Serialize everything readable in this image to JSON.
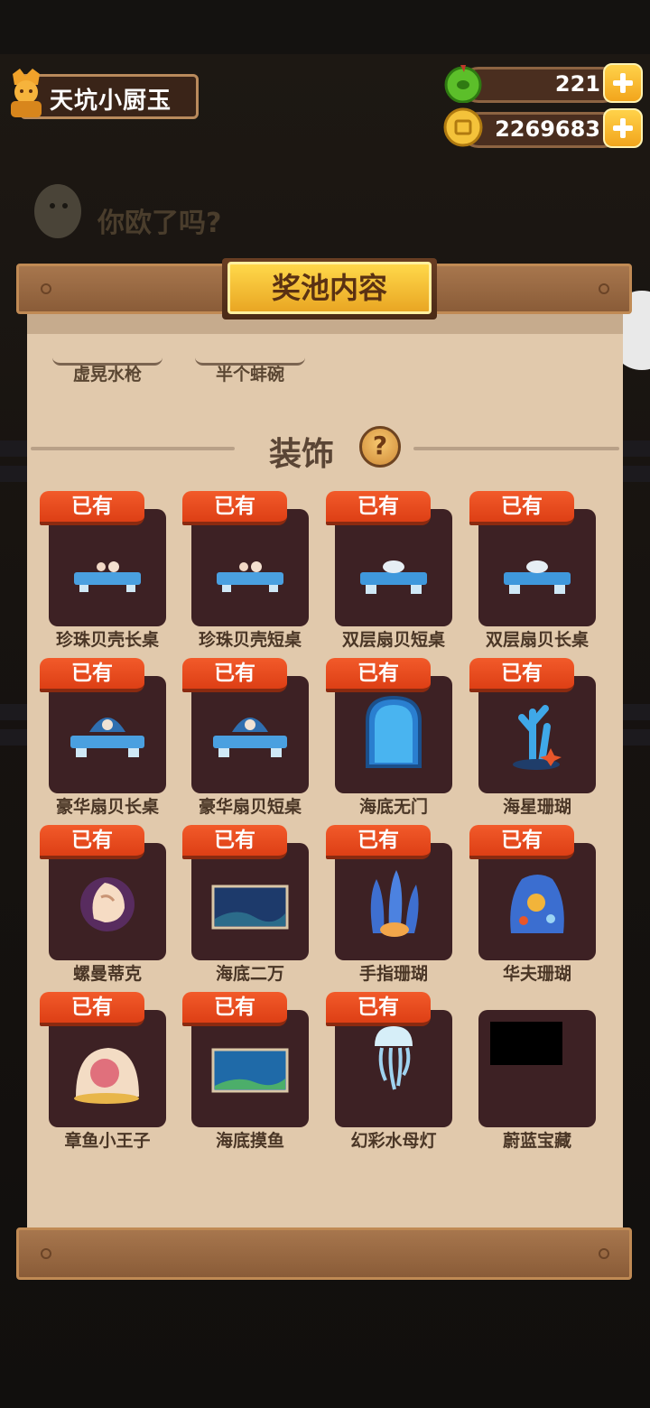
{
  "header": {
    "player_name": "天坑小厨玉",
    "gems": "221",
    "coins": "2269683",
    "banner_text": "你欧了吗?"
  },
  "panel": {
    "title": "奖池内容",
    "previous_items": [
      "虚晃水枪",
      "半个蚌碗"
    ],
    "section_title": "装饰",
    "help_symbol": "?",
    "owned_tag": "已有",
    "items": [
      {
        "name": "珍珠贝壳长桌",
        "owned": true,
        "icon": "pearl-shell-long-table"
      },
      {
        "name": "珍珠贝壳短桌",
        "owned": true,
        "icon": "pearl-shell-short-table"
      },
      {
        "name": "双层扇贝短桌",
        "owned": true,
        "icon": "double-scallop-short-table"
      },
      {
        "name": "双层扇贝长桌",
        "owned": true,
        "icon": "double-scallop-long-table"
      },
      {
        "name": "豪华扇贝长桌",
        "owned": true,
        "icon": "luxury-scallop-long-table"
      },
      {
        "name": "豪华扇贝短桌",
        "owned": true,
        "icon": "luxury-scallop-short-table"
      },
      {
        "name": "海底无门",
        "owned": true,
        "icon": "seabed-door"
      },
      {
        "name": "海星珊瑚",
        "owned": true,
        "icon": "starfish-coral"
      },
      {
        "name": "螺曼蒂克",
        "owned": true,
        "icon": "conch-shell"
      },
      {
        "name": "海底二万",
        "owned": true,
        "icon": "seabed-painting"
      },
      {
        "name": "手指珊瑚",
        "owned": true,
        "icon": "finger-coral"
      },
      {
        "name": "华夫珊瑚",
        "owned": true,
        "icon": "waffle-coral"
      },
      {
        "name": "章鱼小王子",
        "owned": true,
        "icon": "octopus-prince"
      },
      {
        "name": "海底摸鱼",
        "owned": true,
        "icon": "seabed-fish-painting"
      },
      {
        "name": "幻彩水母灯",
        "owned": true,
        "icon": "jellyfish-lamp"
      },
      {
        "name": "蔚蓝宝藏",
        "owned": false,
        "icon": "azure-treasure"
      }
    ]
  },
  "colors": {
    "owned_tag": "#e84a1e",
    "card_bg": "#3d2124",
    "panel_bg": "#e1c9ac",
    "title_gold": "#f2b930"
  }
}
